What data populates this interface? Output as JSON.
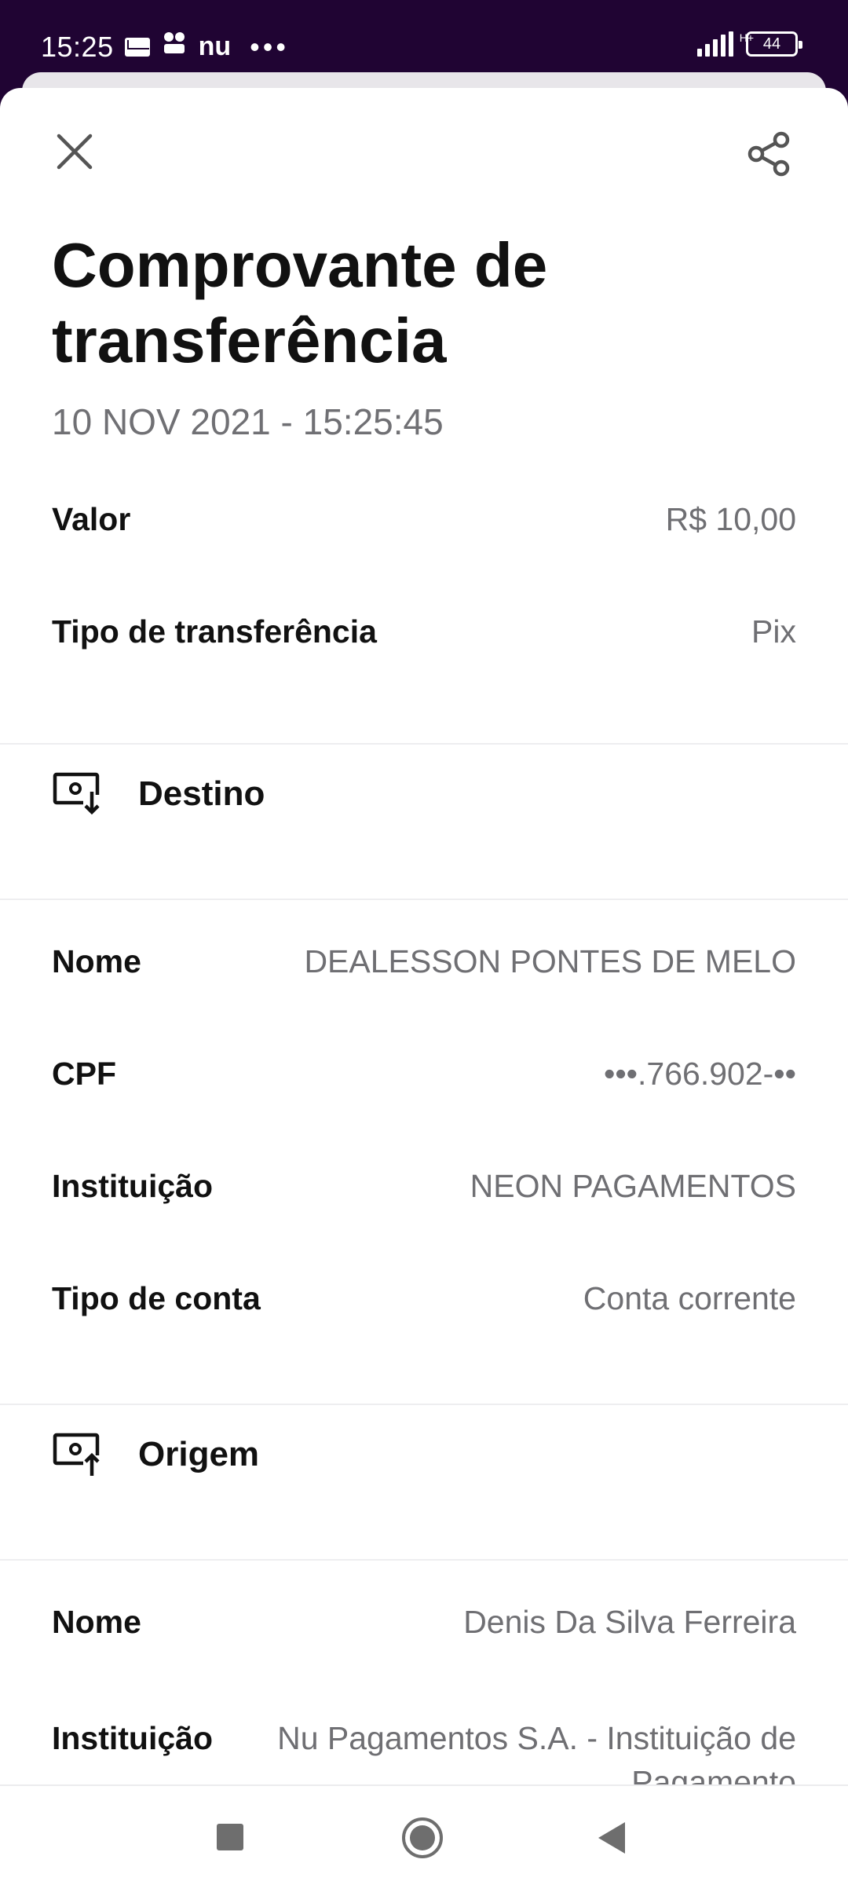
{
  "status_bar": {
    "time": "15:25",
    "app_icons": [
      "mail-icon",
      "community-icon",
      "nubank-icon"
    ],
    "app_text": "nu",
    "overflow": "•••",
    "network_type": "H+",
    "battery": "44"
  },
  "header": {
    "title": "Comprovante de transferência",
    "datetime": "10 NOV 2021 - 15:25:45"
  },
  "summary": [
    {
      "label": "Valor",
      "value": "R$ 10,00"
    },
    {
      "label": "Tipo de transferência",
      "value": "Pix"
    }
  ],
  "destino": {
    "title": "Destino",
    "rows": [
      {
        "label": "Nome",
        "value": "DEALESSON PONTES DE MELO"
      },
      {
        "label": "CPF",
        "value": "•••.766.902-••"
      },
      {
        "label": "Instituição",
        "value": "NEON PAGAMENTOS"
      },
      {
        "label": "Tipo de conta",
        "value": "Conta corrente"
      }
    ]
  },
  "origem": {
    "title": "Origem",
    "rows": [
      {
        "label": "Nome",
        "value": "Denis Da Silva Ferreira"
      },
      {
        "label": "Instituição",
        "value": "Nu Pagamentos S.A. - Instituição de Pagamento"
      }
    ]
  },
  "colors": {
    "status_bar_bg": "#200433",
    "value_text": "#6f6f73",
    "label_text": "#111111"
  }
}
